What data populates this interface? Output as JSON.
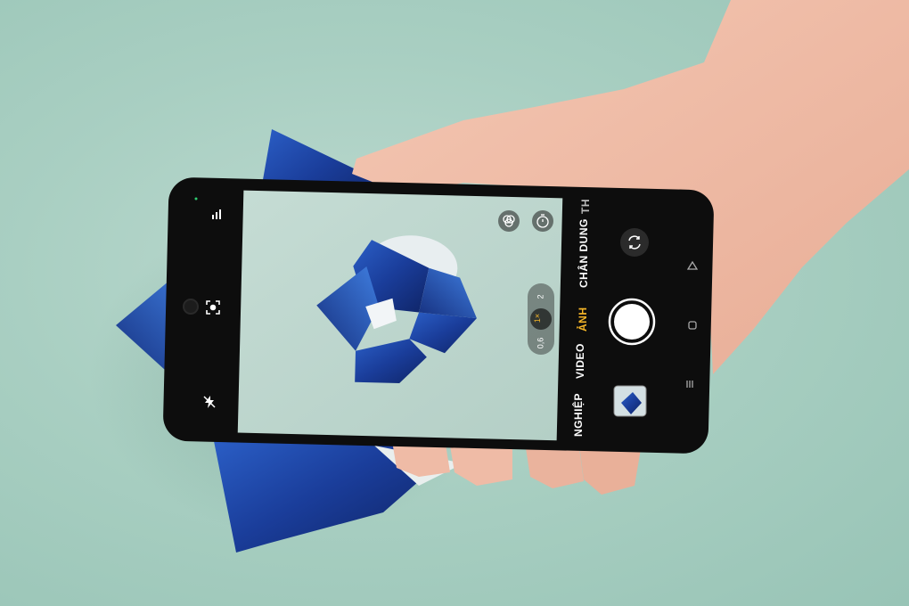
{
  "camera": {
    "modes": {
      "portrait": "CHÂN DUNG",
      "photo": "ẢNH",
      "video": "VIDEO",
      "pro": "NGHIỆP",
      "more": "TH"
    },
    "zoom": {
      "wide": "0,6",
      "normal": "1×",
      "tele": "2"
    }
  },
  "colors": {
    "background": "#a9cfc2",
    "phone_body": "#0d0d0d",
    "active_mode": "#f3b428",
    "cube_blue": "#1d3f9c"
  },
  "icons": {
    "grid": "signal-bars-icon",
    "focus": "focus-frame-icon",
    "flash": "flash-off-icon",
    "filters": "filters-icon",
    "timer": "timer-icon",
    "switch": "switch-camera-icon",
    "back": "nav-back-icon",
    "home": "nav-home-icon",
    "recent": "nav-recent-icon"
  }
}
